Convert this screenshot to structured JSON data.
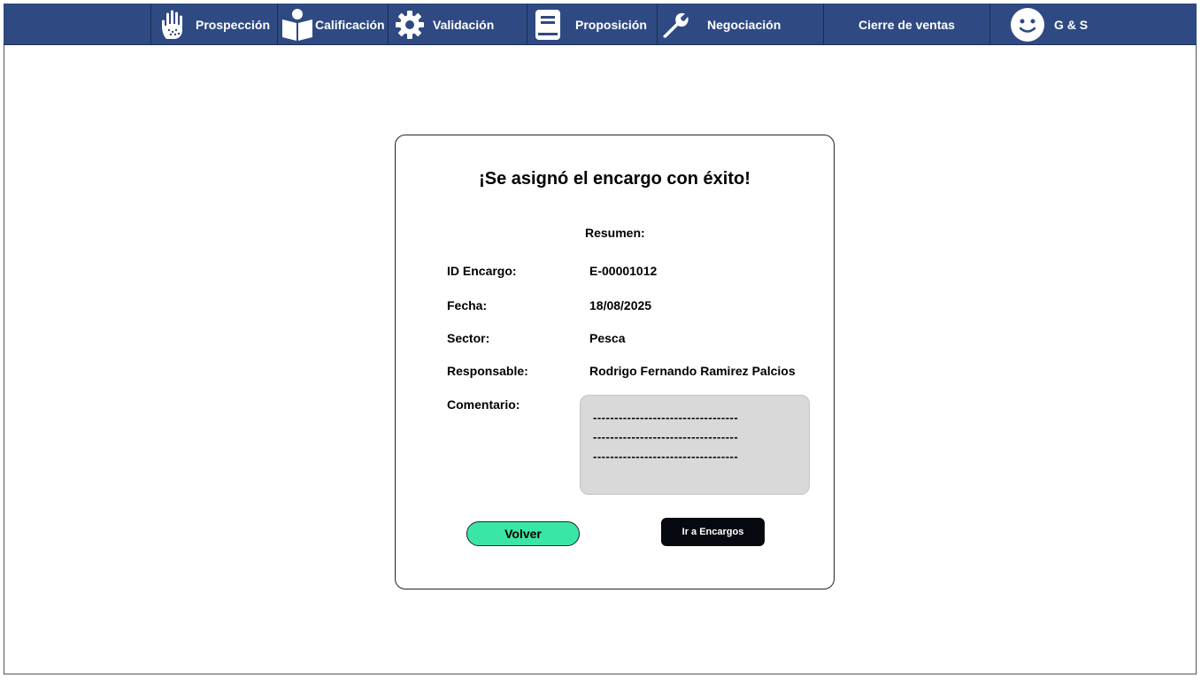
{
  "nav": {
    "items": [
      {
        "label": "Prospección",
        "icon": "hand-icon"
      },
      {
        "label": "Calificación",
        "icon": "reader-icon"
      },
      {
        "label": "Validación",
        "icon": "gear-icon"
      },
      {
        "label": "Proposición",
        "icon": "book-icon"
      },
      {
        "label": "Negociación",
        "icon": "wrench-icon"
      },
      {
        "label": "Cierre de ventas",
        "icon": ""
      }
    ],
    "user": {
      "label": "G & S",
      "icon": "smiley-icon"
    },
    "colors": {
      "bar": "#2f4a82",
      "text": "#ffffff"
    }
  },
  "dialog": {
    "title": "¡Se asignó el encargo con éxito!",
    "summary_label": "Resumen:",
    "fields": [
      {
        "label": "ID Encargo:",
        "value": "E-00001012"
      },
      {
        "label": "Fecha:",
        "value": "18/08/2025"
      },
      {
        "label": "Sector:",
        "value": "Pesca"
      },
      {
        "label": "Responsable:",
        "value": "Rodrigo Fernando Ramirez Palcios"
      }
    ],
    "comment_label": "Comentario:",
    "comment_lines": [
      "----------------------------------",
      "----------------------------------",
      "----------------------------------"
    ],
    "buttons": {
      "back": "Volver",
      "go_orders": "Ir a Encargos"
    },
    "colors": {
      "back_button": "#3ae6a6",
      "orders_button": "#06090f",
      "comment_bg": "#d9d9d9"
    }
  }
}
